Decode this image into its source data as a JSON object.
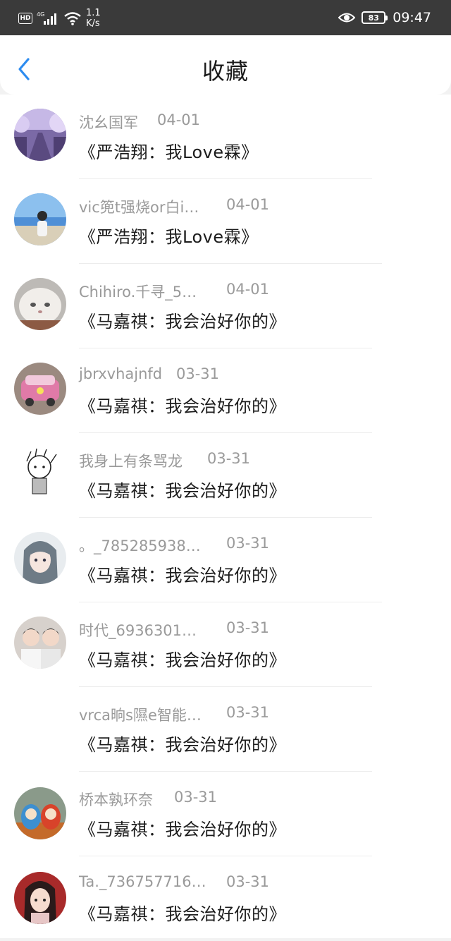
{
  "status_bar": {
    "hd": "HD",
    "network": "4G",
    "speed_value": "1.1",
    "speed_unit": "K/s",
    "battery": "83",
    "time": "09:47",
    "icons": [
      "hd-icon",
      "signal-icon",
      "wifi-icon",
      "eye-icon",
      "battery-icon"
    ]
  },
  "header": {
    "title": "收藏",
    "back_icon": "chevron-left-icon",
    "back_color": "#2d8cf0"
  },
  "items": [
    {
      "user": "沈幺国军",
      "date": "04-01",
      "title": "《严浩翔：我Love霖》",
      "avatar": "purple-street"
    },
    {
      "user": "vic篼t强烧or白i…",
      "date": "04-01",
      "title": "《严浩翔：我Love霖》",
      "avatar": "beach-person"
    },
    {
      "user": "Chihiro.千寻_5…",
      "date": "04-01",
      "title": "《马嘉祺：我会治好你的》",
      "avatar": "white-cat"
    },
    {
      "user": "jbrxvhajnfd",
      "date": "03-31",
      "title": "《马嘉祺：我会治好你的》",
      "avatar": "toy-car"
    },
    {
      "user": "我身上有条骂龙",
      "date": "03-31",
      "title": "《马嘉祺：我会治好你的》",
      "avatar": "sketch-character"
    },
    {
      "user": "。_785285938…",
      "date": "03-31",
      "title": "《马嘉祺：我会治好你的》",
      "avatar": "anime-girl"
    },
    {
      "user": "时代_6936301…",
      "date": "03-31",
      "title": "《马嘉祺：我会治好你的》",
      "avatar": "two-boys"
    },
    {
      "user": "vrca晌s隰e智能…",
      "date": "03-31",
      "title": "《马嘉祺：我会治好你的》",
      "avatar": "none"
    },
    {
      "user": "桥本孰环奈",
      "date": "03-31",
      "title": "《马嘉祺：我会治好你的》",
      "avatar": "daruma-dolls"
    },
    {
      "user": "Ta._736757716…",
      "date": "03-31",
      "title": "《马嘉祺：我会治好你的》",
      "avatar": "red-anime-girl"
    }
  ]
}
